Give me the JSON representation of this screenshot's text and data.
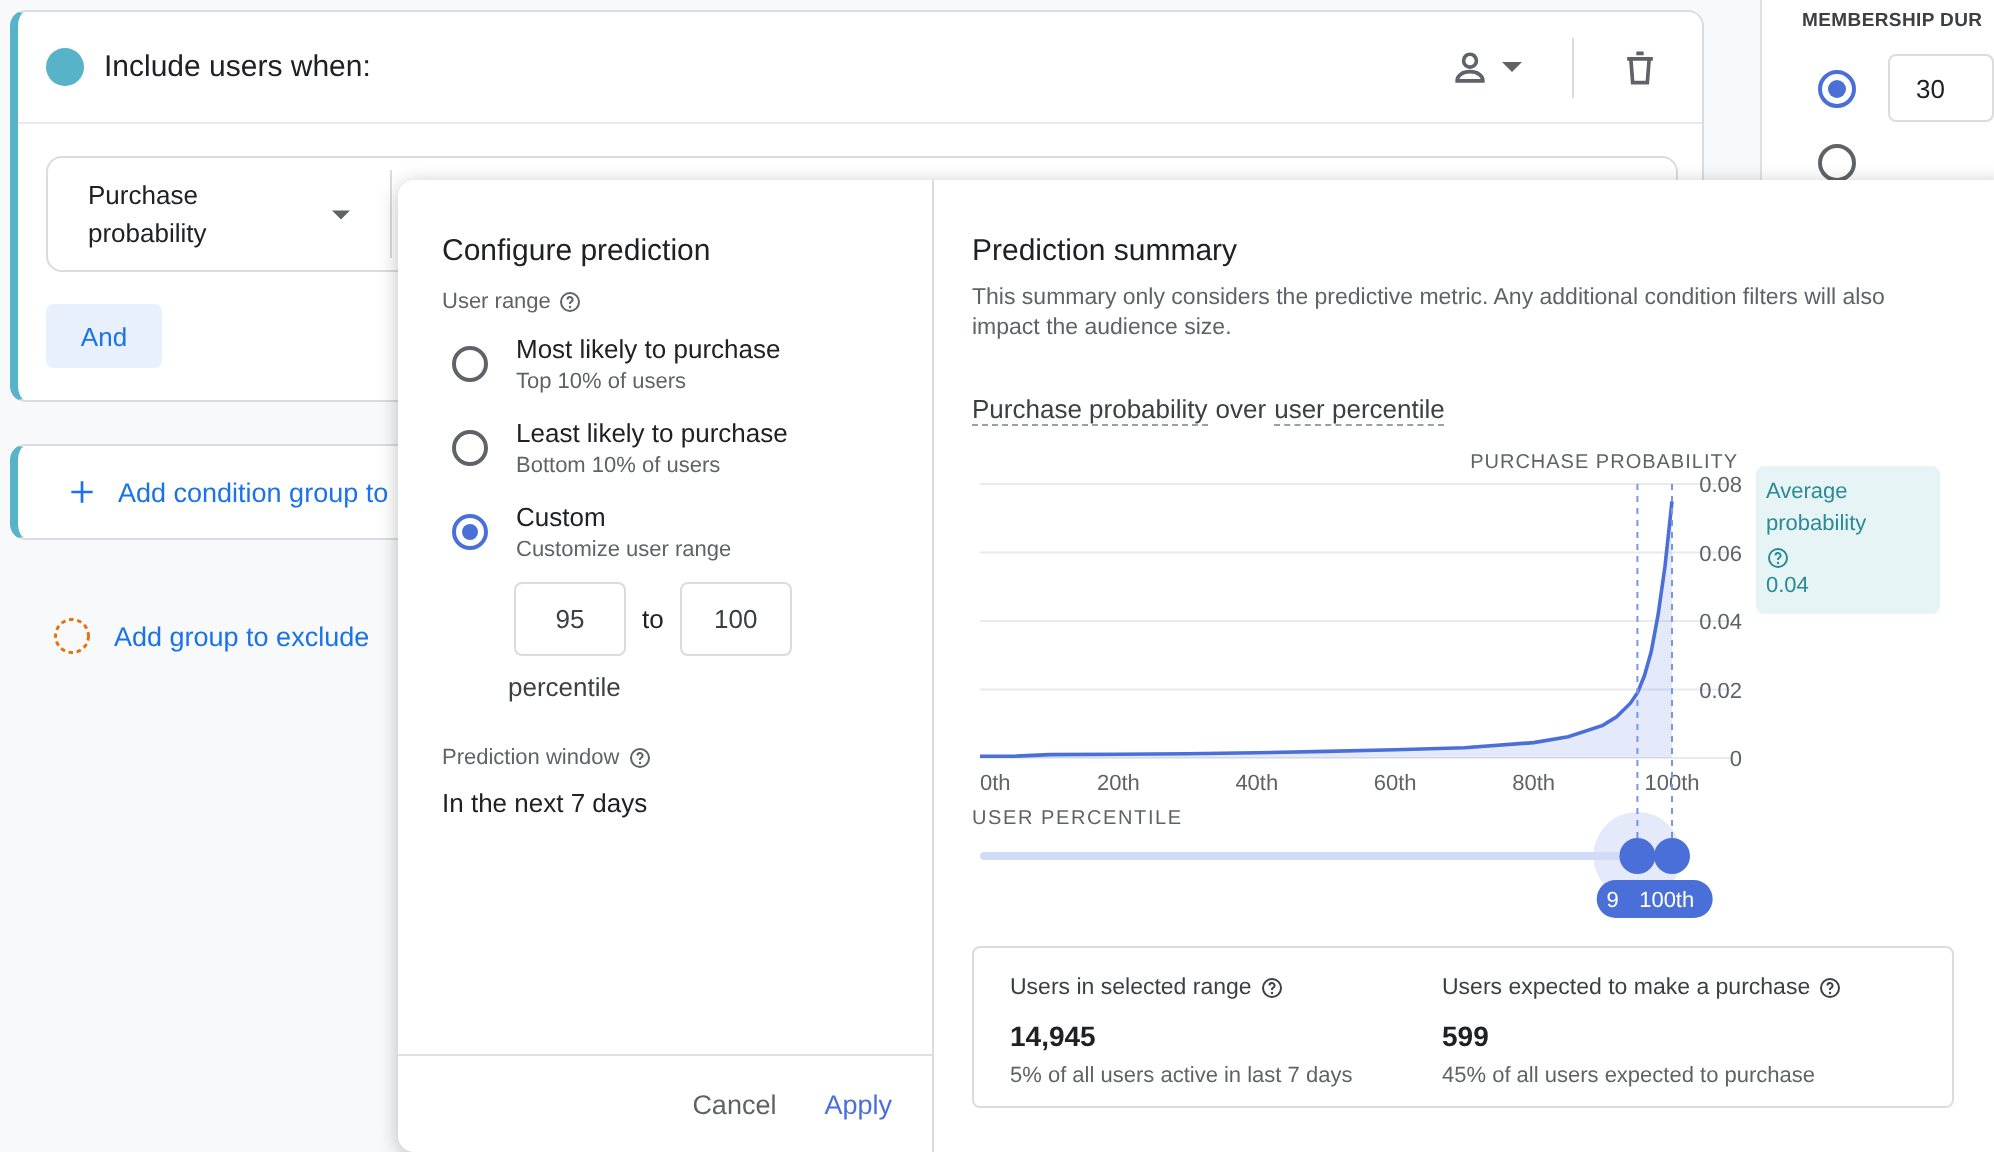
{
  "condition_group": {
    "title": "Include users when:",
    "dimension": {
      "label": "Purchase probability"
    },
    "and_button": "And"
  },
  "add_condition_group": "Add condition group to",
  "add_exclude_group": "Add group to exclude",
  "membership_panel": {
    "heading": "MEMBERSHIP DUR",
    "options": [
      {
        "selected": true,
        "value": "30"
      },
      {
        "selected": false
      }
    ]
  },
  "dialog": {
    "config": {
      "title": "Configure prediction",
      "user_range_label": "User range",
      "options": [
        {
          "label": "Most likely to purchase",
          "description": "Top 10% of users",
          "selected": false
        },
        {
          "label": "Least likely to purchase",
          "description": "Bottom 10% of users",
          "selected": false
        },
        {
          "label": "Custom",
          "description": "Customize user range",
          "selected": true
        }
      ],
      "range_from": "95",
      "range_joiner": "to",
      "range_to": "100",
      "range_unit": "percentile",
      "window_label": "Prediction window",
      "window_value": "In the next 7 days",
      "buttons": [
        {
          "label": "Cancel",
          "kind": "text"
        },
        {
          "label": "Apply",
          "kind": "primary"
        }
      ]
    },
    "summary": {
      "title": "Prediction summary",
      "description": "This summary only considers the predictive metric. Any additional condition filters will also impact the audience size.",
      "chart_heading": {
        "metric": "Purchase probability",
        "joiner": "over",
        "dimension": "user percentile"
      },
      "chart_data": {
        "type": "line",
        "xlabel": "USER PERCENTILE",
        "ylabel": "PURCHASE PROBABILITY",
        "x": [
          0,
          5,
          10,
          20,
          30,
          40,
          50,
          60,
          70,
          80,
          85,
          90,
          92,
          94,
          95,
          96,
          97,
          98,
          99,
          100
        ],
        "series": [
          {
            "color": "#4a6fd8",
            "values": [
              0.0005,
              0.0005,
              0.001,
              0.0011,
              0.0012,
              0.0015,
              0.0019,
              0.0024,
              0.003,
              0.0045,
              0.0062,
              0.0095,
              0.012,
              0.016,
              0.019,
              0.024,
              0.031,
              0.042,
              0.056,
              0.075
            ]
          }
        ],
        "grid": true,
        "ref_lines": [
          {
            "axis": "x",
            "value": 95
          },
          {
            "axis": "x",
            "value": 100
          }
        ],
        "xlim": [
          0,
          100
        ],
        "ylim": [
          0,
          0.08
        ],
        "xticks": [
          {
            "value": 0,
            "label": "0th"
          },
          {
            "value": 20,
            "label": "20th"
          },
          {
            "value": 40,
            "label": "40th"
          },
          {
            "value": 60,
            "label": "60th"
          },
          {
            "value": 80,
            "label": "80th"
          },
          {
            "value": 100,
            "label": "100th"
          }
        ],
        "yticks": [
          {
            "value": 0.08,
            "label": "0.08"
          },
          {
            "value": 0.06,
            "label": "0.06"
          },
          {
            "value": 0.04,
            "label": "0.04"
          },
          {
            "value": 0.02,
            "label": "0.02"
          },
          {
            "value": 0,
            "label": "0"
          }
        ]
      },
      "range_slider": {
        "thumbs": [
          {
            "level": 0.95,
            "label": "9"
          },
          {
            "level": 1,
            "label": "100th"
          }
        ]
      },
      "average": {
        "label": "Average probability",
        "value": "0.04"
      },
      "stats": [
        {
          "label": "Users in selected range",
          "value": "14,945",
          "note": "5% of all users active in last 7 days"
        },
        {
          "label": "Users expected to make a purchase",
          "value": "599",
          "note": "45% of all users expected to purchase"
        }
      ]
    }
  }
}
